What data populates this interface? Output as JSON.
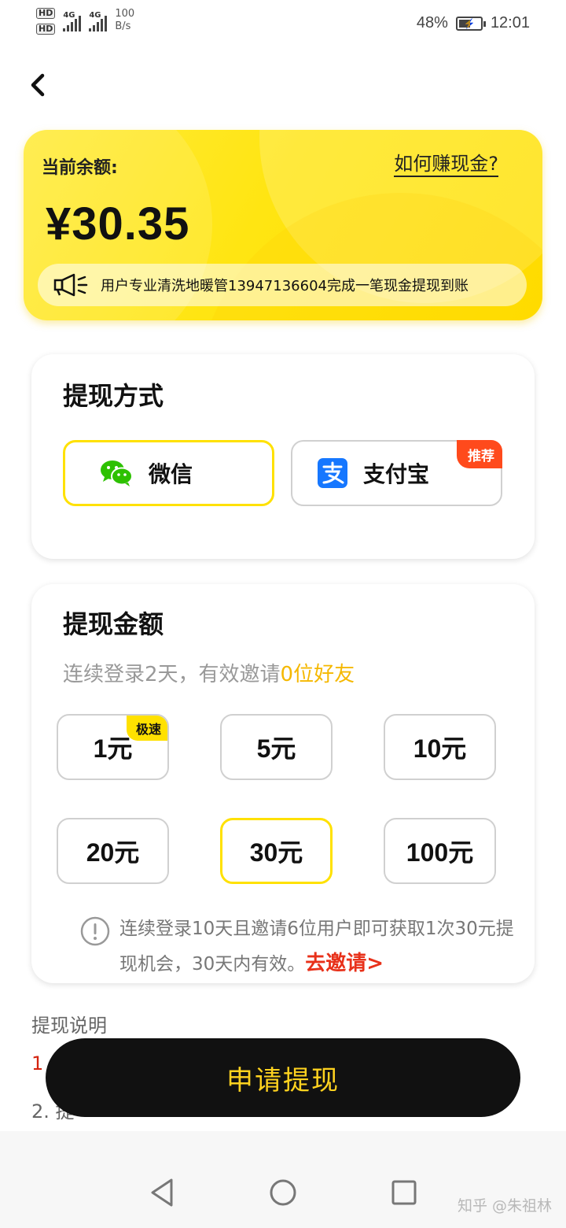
{
  "status_bar": {
    "hd1": "HD",
    "hd2": "HD",
    "net1": "4G",
    "net2": "4G",
    "speed_value": "100",
    "speed_unit": "B/s",
    "battery": "48%",
    "time": "12:01"
  },
  "balance": {
    "label": "当前余额:",
    "how_to_earn": "如何赚现金?",
    "amount": "¥30.35",
    "notice": "用户专业清洗地暖管13947136604完成一笔现金提现到账",
    "notice_icon": "megaphone-icon"
  },
  "withdraw_method": {
    "title": "提现方式",
    "options": [
      {
        "label": "微信",
        "icon": "wechat-icon",
        "selected": true
      },
      {
        "label": "支付宝",
        "icon": "alipay-icon",
        "badge": "推荐",
        "selected": false
      }
    ]
  },
  "withdraw_amount": {
    "title": "提现金额",
    "condition_prefix": "连续登录2天，有效邀请",
    "condition_highlight": "0位好友",
    "amounts": [
      {
        "label": "1元",
        "badge": "极速",
        "selected": false
      },
      {
        "label": "5元",
        "selected": false
      },
      {
        "label": "10元",
        "selected": false
      },
      {
        "label": "20元",
        "selected": false
      },
      {
        "label": "30元",
        "selected": true
      },
      {
        "label": "100元",
        "selected": false
      }
    ],
    "tip_text": "连续登录10天且邀请6位用户即可获取1次30元提现机会，30天内有效。",
    "invite_link": "去邀请>"
  },
  "description": {
    "title": "提现说明",
    "item1": "1",
    "item2": "2. 提"
  },
  "submit_label": "申请提现",
  "watermark": "知乎 @朱祖林",
  "colors": {
    "accent_yellow": "#ffe100",
    "submit_bg": "#111111",
    "submit_text": "#ffd21f",
    "badge_red": "#ff4a1c",
    "invite_red": "#e8311a",
    "wechat_green": "#2dc100",
    "alipay_blue": "#1677ff"
  }
}
